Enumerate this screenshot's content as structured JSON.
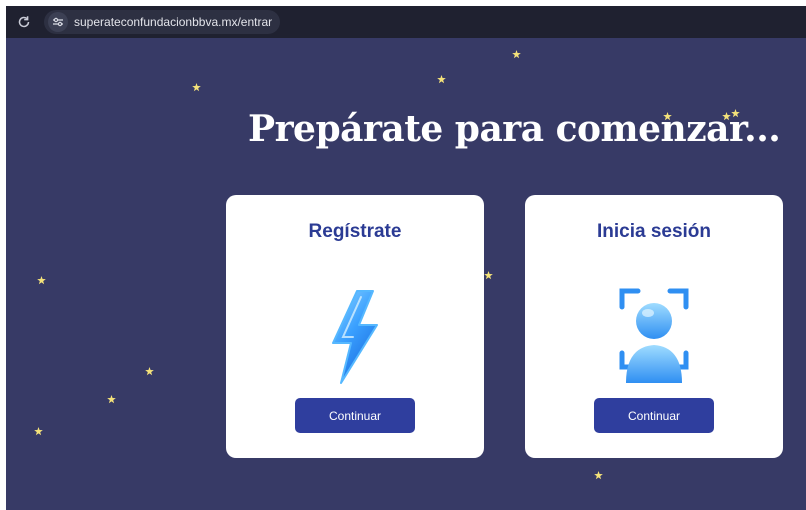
{
  "browser": {
    "url": "superateconfundacionbbva.mx/entrar",
    "reload_icon": "reload-icon",
    "site_info_icon": "site-settings-icon"
  },
  "page": {
    "title": "Prepárate para comenzar...",
    "background_color": "#373a66",
    "star_color": "#f4e27a"
  },
  "cards": [
    {
      "title": "Regístrate",
      "icon": "lightning-bolt-icon",
      "button_label": "Continuar"
    },
    {
      "title": "Inicia sesión",
      "icon": "face-id-user-icon",
      "button_label": "Continuar"
    }
  ],
  "colors": {
    "accent": "#2f3e9e",
    "heading": "#2b3b94",
    "icon_blue": "#3aa0ff"
  }
}
